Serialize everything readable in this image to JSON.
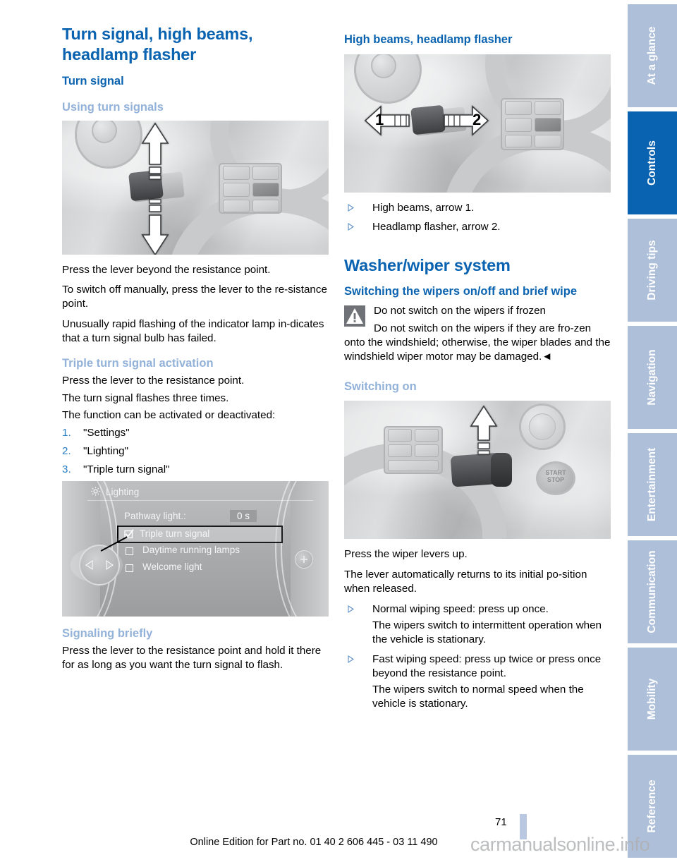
{
  "document": {
    "page_number": "71",
    "footer_text": "Online Edition for Part no. 01 40 2 606 445 - 03 11 490",
    "watermark": "carmanualsonline.info"
  },
  "colors": {
    "heading_blue": "#0a63b0",
    "subheading_blue": "#93b2d9",
    "tab_inactive": "#aebfda",
    "tab_active": "#0a63b0",
    "number_blue": "#2a7fc9"
  },
  "left_column": {
    "title": "Turn signal, high beams, headlamp flasher",
    "section_heading": "Turn signal",
    "sub1_heading": "Using turn signals",
    "figure1": {
      "alt": "Turn signal stalk on steering column with up and down arrows",
      "arrow_up": "up",
      "arrow_down": "down"
    },
    "sub1_paragraphs": [
      "Press the lever beyond the resistance point.",
      "To switch off manually, press the lever to the re-sistance point.",
      "Unusually rapid flashing of the indicator lamp in-dicates that a turn signal bulb has failed."
    ],
    "sub2_heading": "Triple turn signal activation",
    "sub2_paragraphs": [
      "Press the lever to the resistance point.",
      "The turn signal flashes three times.",
      "The function can be activated or deactivated:"
    ],
    "sub2_steps": [
      {
        "number": "1.",
        "label": "\"Settings\""
      },
      {
        "number": "2.",
        "label": "\"Lighting\""
      },
      {
        "number": "3.",
        "label": "\"Triple turn signal\""
      }
    ],
    "idrive": {
      "title": "Lighting",
      "gear_icon": "gear-icon",
      "setting_label": "Pathway light.:",
      "setting_value": "0 s",
      "options": [
        {
          "label": "Triple turn signal",
          "checked": true,
          "selected": true
        },
        {
          "label": "Daytime running lamps",
          "checked": false,
          "selected": false
        },
        {
          "label": "Welcome light",
          "checked": false,
          "selected": false
        }
      ]
    },
    "sub3_heading": "Signaling briefly",
    "sub3_paragraphs": [
      "Press the lever to the resistance point and hold it there for as long as you want the turn signal to flash."
    ]
  },
  "right_column": {
    "sub1_heading": "High beams, headlamp flasher",
    "figure2": {
      "alt": "Turn signal stalk with left arrow 1 and right arrow 2",
      "arrow_1_label": "1",
      "arrow_2_label": "2"
    },
    "bullets1": [
      "High beams, arrow 1.",
      "Headlamp flasher, arrow 2."
    ],
    "title2": "Washer/wiper system",
    "sub2_heading": "Switching the wipers on/off and brief wipe",
    "warning": {
      "icon": "warning-triangle-icon",
      "headline": "Do not switch on the wipers if frozen",
      "body": "Do not switch on the wipers if they are fro-zen onto the windshield; otherwise, the wiper blades and the windshield wiper motor may be damaged.",
      "end_marker": "◄"
    },
    "sub3_heading": "Switching on",
    "figure3": {
      "alt": "Wiper lever with upward arrow and START STOP button",
      "arrow_up": "up",
      "start_stop_label": "START STOP"
    },
    "paragraphs": [
      "Press the wiper levers up.",
      "The lever automatically returns to its initial po-sition when released."
    ],
    "bullets2": [
      {
        "main": "Normal wiping speed: press up once.",
        "sub": "The wipers switch to intermittent operation when the vehicle is stationary."
      },
      {
        "main": "Fast wiping speed: press up twice or press once beyond the resistance point.",
        "sub": "The wipers switch to normal speed when the vehicle is stationary."
      }
    ]
  },
  "tabs": [
    {
      "label": "At a glance",
      "active": false
    },
    {
      "label": "Controls",
      "active": true
    },
    {
      "label": "Driving tips",
      "active": false
    },
    {
      "label": "Navigation",
      "active": false
    },
    {
      "label": "Entertainment",
      "active": false
    },
    {
      "label": "Communication",
      "active": false
    },
    {
      "label": "Mobility",
      "active": false
    },
    {
      "label": "Reference",
      "active": false
    }
  ]
}
